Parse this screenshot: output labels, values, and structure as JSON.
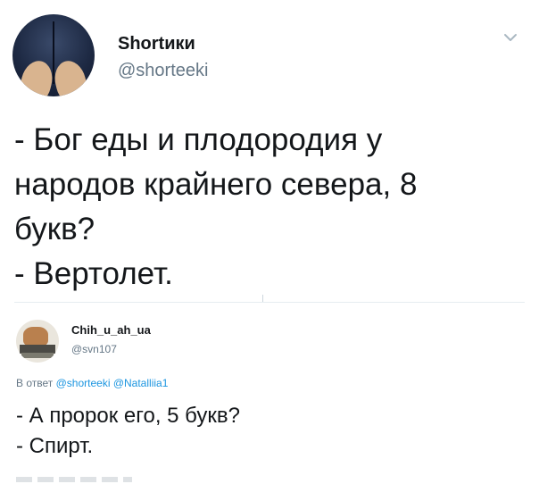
{
  "main_tweet": {
    "author_name": "Shortики",
    "author_handle": "@shorteeki",
    "text_lines": [
      "- Бог еды и плодородия у",
      "народов крайнего севера, 8",
      "букв?",
      "- Вертолет."
    ],
    "menu_icon": "chevron-down-icon"
  },
  "reply_tweet": {
    "author_name": "Chih_u_ah_ua",
    "author_handle": "@svn107",
    "reply_prefix": "В ответ",
    "reply_mentions": [
      "@shorteeki",
      "@Natalliia1"
    ],
    "text_lines": [
      "- А пророк его, 5 букв?",
      "- Спирт."
    ]
  },
  "colors": {
    "text": "#14171a",
    "secondary": "#657786",
    "link": "#1b95e0",
    "divider": "#e6ecf0"
  }
}
